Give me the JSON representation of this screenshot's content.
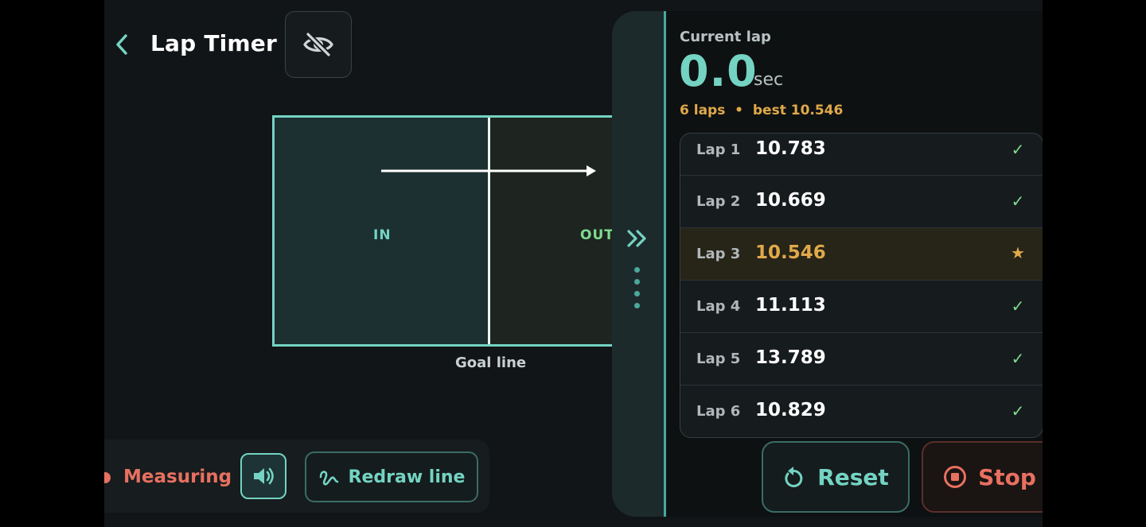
{
  "header": {
    "title": "Lap Timer",
    "back_icon": "chevron-left-icon",
    "visibility_icon": "eye-off-icon"
  },
  "zone": {
    "in_label": "IN",
    "out_label": "OUT",
    "goal_caption": "Goal line"
  },
  "status": {
    "measuring_label": "Measuring",
    "sound_icon": "speaker-icon",
    "redraw_label": "Redraw line"
  },
  "panel": {
    "current_label": "Current lap",
    "current_value": "0.0",
    "current_unit": "sec",
    "summary": "6 laps  •  best 10.546",
    "laps": [
      {
        "name": "Lap 1",
        "time": "10.783",
        "mark": "✓",
        "best": false
      },
      {
        "name": "Lap 2",
        "time": "10.669",
        "mark": "✓",
        "best": false
      },
      {
        "name": "Lap 3",
        "time": "10.546",
        "mark": "★",
        "best": true
      },
      {
        "name": "Lap 4",
        "time": "11.113",
        "mark": "✓",
        "best": false
      },
      {
        "name": "Lap 5",
        "time": "13.789",
        "mark": "✓",
        "best": false
      },
      {
        "name": "Lap 6",
        "time": "10.829",
        "mark": "✓",
        "best": false
      }
    ]
  },
  "actions": {
    "reset_label": "Reset",
    "stop_label": "Stop"
  },
  "colors": {
    "accent": "#74d3c3",
    "best": "#e0a94a",
    "stop": "#e87060",
    "check": "#7fdc8f"
  }
}
